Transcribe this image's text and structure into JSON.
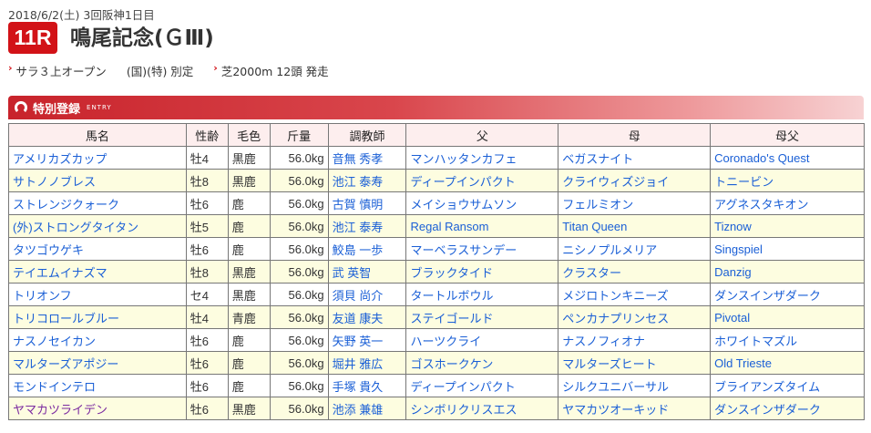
{
  "header": {
    "date": "2018/6/2(土) 3回阪神1日目",
    "race_number": "11R",
    "race_name": "鳴尾記念(ＧⅢ)",
    "conditions": "サラ３上オープン",
    "conditions2": "(国)(特) 別定",
    "course": "芝2000m 12頭 発走"
  },
  "section": {
    "label": "特別登録",
    "sublabel": "ENTRY"
  },
  "columns": [
    "馬名",
    "性齢",
    "毛色",
    "斤量",
    "調教師",
    "父",
    "母",
    "母父"
  ],
  "rows": [
    [
      "アメリカズカップ",
      "牡4",
      "黒鹿",
      "56.0kg",
      "音無 秀孝",
      "マンハッタンカフェ",
      "ベガスナイト",
      "Coronado's Quest"
    ],
    [
      "サトノノブレス",
      "牡8",
      "黒鹿",
      "56.0kg",
      "池江 泰寿",
      "ディープインパクト",
      "クライウィズジョイ",
      "トニービン"
    ],
    [
      "ストレンジクォーク",
      "牡6",
      "鹿",
      "56.0kg",
      "古賀 慎明",
      "メイショウサムソン",
      "フェルミオン",
      "アグネスタキオン"
    ],
    [
      "(外)ストロングタイタン",
      "牡5",
      "鹿",
      "56.0kg",
      "池江 泰寿",
      "Regal Ransom",
      "Titan Queen",
      "Tiznow"
    ],
    [
      "タツゴウゲキ",
      "牡6",
      "鹿",
      "56.0kg",
      "鮫島 一歩",
      "マーベラスサンデー",
      "ニシノプルメリア",
      "Singspiel"
    ],
    [
      "テイエムイナズマ",
      "牡8",
      "黒鹿",
      "56.0kg",
      "武 英智",
      "ブラックタイド",
      "クラスター",
      "Danzig"
    ],
    [
      "トリオンフ",
      "セ4",
      "黒鹿",
      "56.0kg",
      "須貝 尚介",
      "タートルボウル",
      "メジロトンキニーズ",
      "ダンスインザダーク"
    ],
    [
      "トリコロールブルー",
      "牡4",
      "青鹿",
      "56.0kg",
      "友道 康夫",
      "ステイゴールド",
      "ペンカナプリンセス",
      "Pivotal"
    ],
    [
      "ナスノセイカン",
      "牡6",
      "鹿",
      "56.0kg",
      "矢野 英一",
      "ハーツクライ",
      "ナスノフィオナ",
      "ホワイトマズル"
    ],
    [
      "マルターズアポジー",
      "牡6",
      "鹿",
      "56.0kg",
      "堀井 雅広",
      "ゴスホークケン",
      "マルターズヒート",
      "Old Trieste"
    ],
    [
      "モンドインテロ",
      "牡6",
      "鹿",
      "56.0kg",
      "手塚 貴久",
      "ディープインパクト",
      "シルクユニバーサル",
      "ブライアンズタイム"
    ],
    [
      "ヤマカツライデン",
      "牡6",
      "黒鹿",
      "56.0kg",
      "池添 兼雄",
      "シンボリクリスエス",
      "ヤマカツオーキッド",
      "ダンスインザダーク"
    ]
  ]
}
